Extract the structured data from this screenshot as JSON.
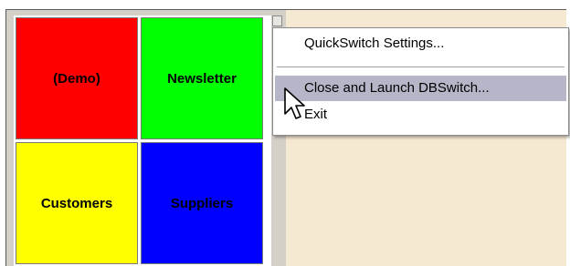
{
  "tiles": [
    {
      "label": "(Demo)",
      "color": "#ff0000"
    },
    {
      "label": "Newsletter",
      "color": "#00ff00"
    },
    {
      "label": "Customers",
      "color": "#ffff00"
    },
    {
      "label": "Suppliers",
      "color": "#0000ff"
    }
  ],
  "context_menu": {
    "items": [
      {
        "label": "QuickSwitch Settings..."
      },
      {
        "label": "Close and Launch DBSwitch...",
        "highlighted": true
      },
      {
        "label": "Exit"
      }
    ]
  },
  "colors": {
    "panel_background": "#f6e9d2",
    "highlight": "#b6b6c8"
  },
  "icons": {
    "cursor": "pointer-cursor-icon"
  }
}
